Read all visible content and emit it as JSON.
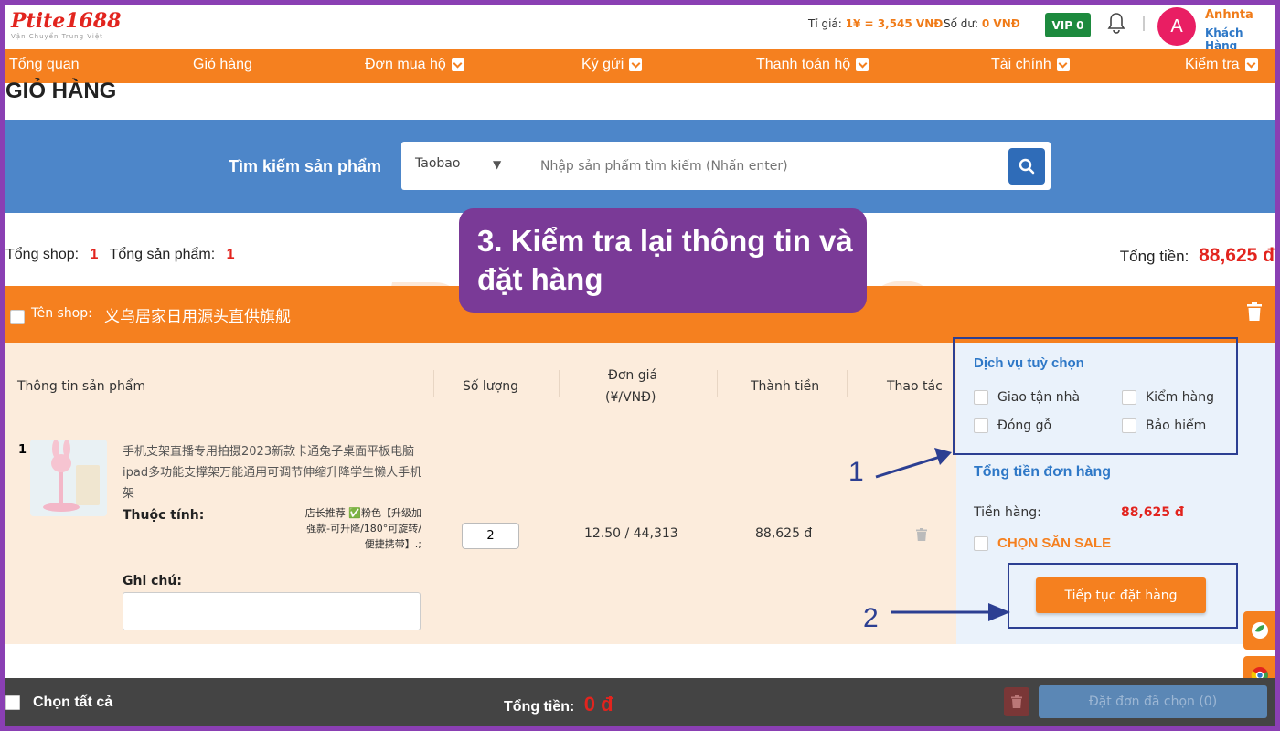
{
  "header": {
    "logo_text": "Ptite1688",
    "logo_sub": "Vận Chuyển Trung Việt",
    "rate_label": "Tỉ giá:",
    "rate_value": "1¥ = 3,545 VNĐ",
    "balance_label": "Số dư:",
    "balance_value": "0 VNĐ",
    "vip": "VIP 0",
    "avatar_letter": "A",
    "user_name": "Anhnta",
    "user_role": "Khách Hàng"
  },
  "nav": {
    "items": [
      {
        "label": "Tổng quan"
      },
      {
        "label": "Giỏ hàng"
      },
      {
        "label": "Đơn mua hộ"
      },
      {
        "label": "Ký gửi"
      },
      {
        "label": "Thanh toán hộ"
      },
      {
        "label": "Tài chính"
      },
      {
        "label": "Kiểm tra"
      }
    ]
  },
  "page_title": "GIỎ HÀNG",
  "search": {
    "label": "Tìm kiếm sản phẩm",
    "source": "Taobao",
    "placeholder": "Nhập sản phẩm tìm kiếm (Nhấn enter)"
  },
  "summary": {
    "shops_label": "Tổng shop:",
    "shops_count": "1",
    "products_label": "Tổng sản phẩm:",
    "products_count": "1",
    "total_label": "Tổng tiền:",
    "total_value": "88,625 đ"
  },
  "shop": {
    "label": "Tên shop:",
    "name": "义乌居家日用源头直供旗舰"
  },
  "table": {
    "headers": {
      "product": "Thông tin sản phẩm",
      "qty": "Số lượng",
      "unit_price_1": "Đơn giá",
      "unit_price_2": "(¥/VNĐ)",
      "subtotal": "Thành tiền",
      "actions": "Thao tác"
    },
    "row": {
      "index": "1",
      "name": "手机支架直播专用拍摄2023新款卡通兔子桌面平板电脑ipad多功能支撑架万能通用可调节伸缩升降学生懒人手机架",
      "attr_label": "Thuộc tính:",
      "attr_value": "店长推荐 ✅粉色【升级加强款-可升降/180°可旋转/便捷携带】.;",
      "note_label": "Ghi chú:",
      "qty": "2",
      "unit_price": "12.50 / 44,313",
      "subtotal": "88,625 đ"
    }
  },
  "side": {
    "services_title": "Dịch vụ tuỳ chọn",
    "options": [
      {
        "label": "Giao tận nhà"
      },
      {
        "label": "Kiểm hàng"
      },
      {
        "label": "Đóng gỗ"
      },
      {
        "label": "Bảo hiểm"
      }
    ],
    "order_total_title": "Tổng tiền đơn hàng",
    "goods_label": "Tiền hàng:",
    "goods_value": "88,625 đ",
    "sale_label": "CHỌN SĂN SALE",
    "continue_button": "Tiếp tục đặt hàng"
  },
  "bottom": {
    "select_all": "Chọn tất cả",
    "total_label": "Tổng tiền:",
    "total_value": "0 đ",
    "order_selected": "Đặt đơn đã chọn (0)"
  },
  "annotation": {
    "callout": "3. Kiểm tra lại thông tin và đặt hàng",
    "marker_1": "1",
    "marker_2": "2"
  },
  "colors": {
    "orange": "#f5801f",
    "blue": "#4d86c9",
    "red": "#e2241e",
    "purple": "#7a3a97",
    "navy": "#2c3f92"
  }
}
